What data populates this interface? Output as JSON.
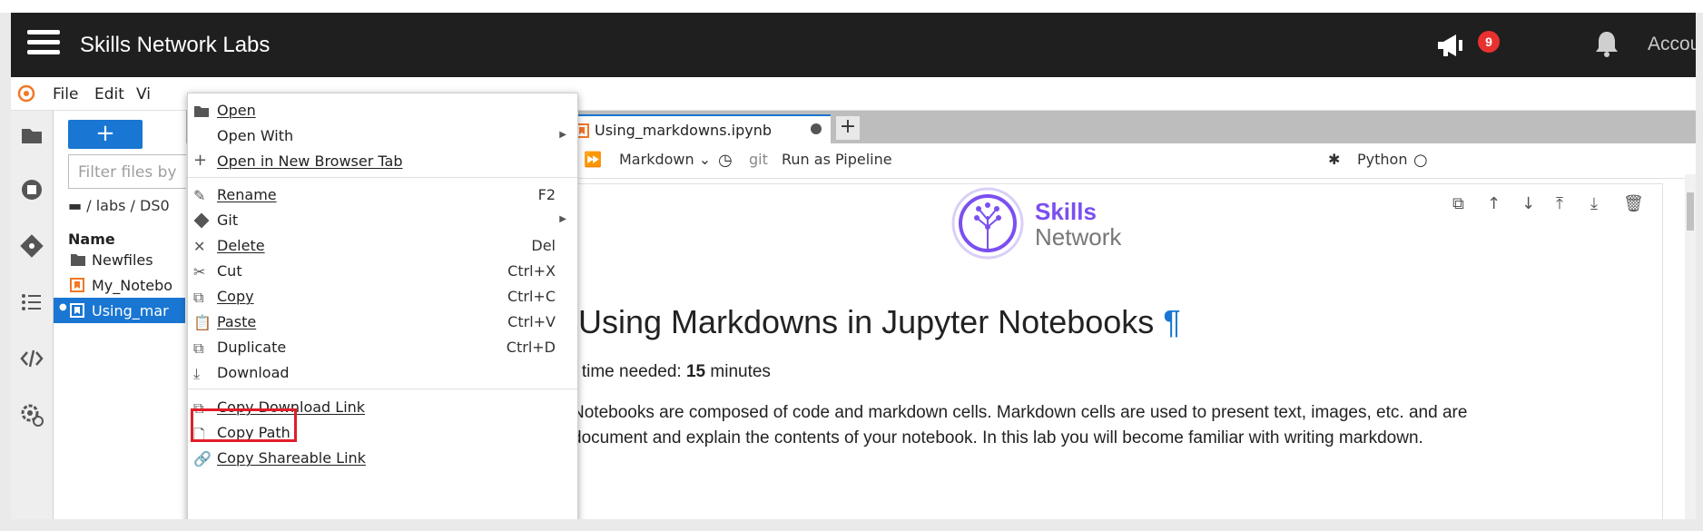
{
  "app": {
    "brand": "Skills Network Labs",
    "notification_count": "9",
    "account_label": "Account"
  },
  "menubar": {
    "items": [
      "File",
      "Edit",
      "Vi"
    ]
  },
  "file_panel": {
    "new_button_label": "+",
    "filter_placeholder": "Filter files by",
    "breadcrumb": "/ labs / DS0",
    "column_name": "Name",
    "files": [
      {
        "name": "Newfiles",
        "type": "folder"
      },
      {
        "name": "My_Notebo",
        "type": "notebook"
      },
      {
        "name": "Using_mar",
        "type": "notebook",
        "selected": true
      }
    ]
  },
  "tabs": {
    "active_tab": "Using_markdowns.ipynb",
    "add_tab": "+"
  },
  "toolbar": {
    "cell_type": "Markdown",
    "git_label": "git",
    "pipeline_label": "Run as Pipeline",
    "kernel": "Python"
  },
  "notebook": {
    "logo_line1": "Skills",
    "logo_line2": "Network",
    "heading": "Using Markdowns in Jupyter Notebooks",
    "pilcrow": "¶",
    "estimate_prefix": "d time needed: ",
    "estimate_value": "15",
    "estimate_suffix": " minutes",
    "para_line1": "Notebooks are composed of code and markdown cells. Markdown cells are used to present text, images, etc. and are",
    "para_line2": "document and explain the contents of your notebook. In this lab you will become familiar with writing markdown."
  },
  "context_menu": {
    "items": [
      {
        "label": "Open",
        "icon": "folder-icon",
        "shortcut": ""
      },
      {
        "label": "Open With",
        "icon": "",
        "shortcut": "",
        "submenu": true
      },
      {
        "label": "Open in New Browser Tab",
        "icon": "plus-icon",
        "shortcut": ""
      },
      {
        "label": "Rename",
        "icon": "pencil-icon",
        "shortcut": "F2"
      },
      {
        "label": "Git",
        "icon": "git-icon",
        "shortcut": "",
        "submenu": true
      },
      {
        "label": "Delete",
        "icon": "close-icon",
        "shortcut": "Del"
      },
      {
        "label": "Cut",
        "icon": "scissors-icon",
        "shortcut": "Ctrl+X"
      },
      {
        "label": "Copy",
        "icon": "copy-icon",
        "shortcut": "Ctrl+C"
      },
      {
        "label": "Paste",
        "icon": "paste-icon",
        "shortcut": "Ctrl+V"
      },
      {
        "label": "Duplicate",
        "icon": "duplicate-icon",
        "shortcut": "Ctrl+D"
      },
      {
        "label": "Download",
        "icon": "download-icon",
        "shortcut": "",
        "highlighted": true
      },
      {
        "label": "Copy Download Link",
        "icon": "copy-icon",
        "shortcut": ""
      },
      {
        "label": "Copy Path",
        "icon": "file-icon",
        "shortcut": ""
      },
      {
        "label": "Copy Shareable Link",
        "icon": "link-icon",
        "shortcut": ""
      }
    ]
  },
  "colors": {
    "accent": "#1976d2",
    "topbar": "#1f1f1f",
    "highlight_border": "#e11d2a",
    "badge": "#e8312f",
    "logo_purple": "#7b4ff0"
  }
}
